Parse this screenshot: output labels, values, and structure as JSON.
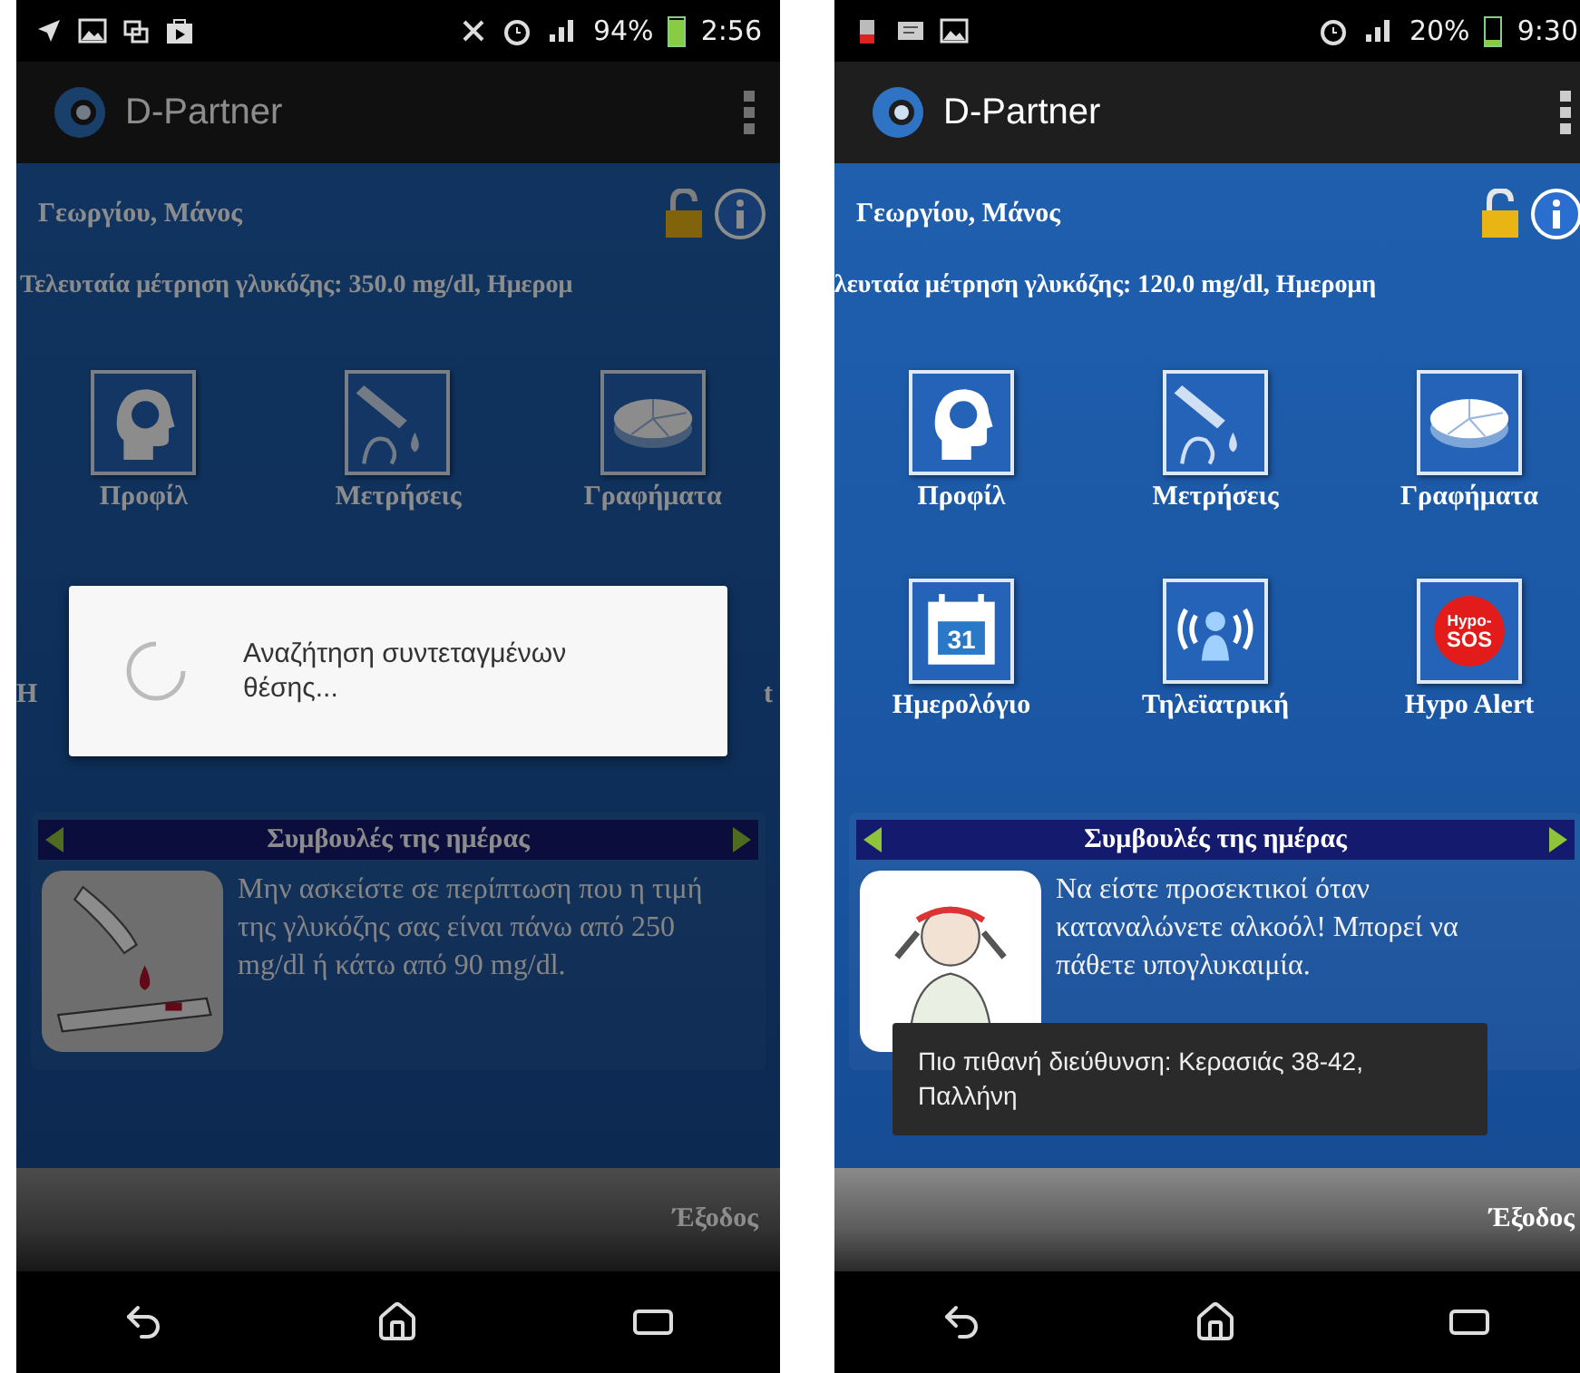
{
  "screens": [
    {
      "dimmed": true,
      "status_bar": {
        "battery": "94%",
        "time": "2:56"
      },
      "app_bar": {
        "title": "D-Partner"
      },
      "user_name": "Γεωργίου, Μάνος",
      "last_reading": "Τελευταία μέτρηση γλυκόζης: 350.0 mg/dl, Ημερομ",
      "tiles": [
        {
          "kind": "profile",
          "label": "Προφίλ"
        },
        {
          "kind": "measure",
          "label": "Μετρήσεις"
        },
        {
          "kind": "charts",
          "label": "Γραφήματα"
        }
      ],
      "partial_labels": [
        "Η",
        "t"
      ],
      "tips": {
        "title": "Συμβουλές της ημέρας",
        "kind": "blood-drop",
        "text": "Μην ασκείστε σε περίπτωση που η τιμή της γλυκόζης σας είναι πάνω από 250 mg/dl ή κάτω από 90 mg/dl."
      },
      "dialog": {
        "message": "Αναζήτηση συντεταγμένων θέσης..."
      },
      "exit": "Έξοδος"
    },
    {
      "dimmed": false,
      "status_bar": {
        "battery": "20%",
        "time": "9:30"
      },
      "app_bar": {
        "title": "D-Partner"
      },
      "user_name": "Γεωργίου, Μάνος",
      "last_reading": "λευταία μέτρηση γλυκόζης: 120.0 mg/dl, Ημερομη",
      "tiles": [
        {
          "kind": "profile",
          "label": "Προφίλ"
        },
        {
          "kind": "measure",
          "label": "Μετρήσεις"
        },
        {
          "kind": "charts",
          "label": "Γραφήματα"
        },
        {
          "kind": "calendar",
          "label": "Ημερολόγιο",
          "icon_text": [
            "31"
          ]
        },
        {
          "kind": "telemedicine",
          "label": "Τηλεϊατρική"
        },
        {
          "kind": "sos",
          "label": "Hypo Alert",
          "icon_text": [
            "Hypo-",
            "SOS"
          ]
        }
      ],
      "tips": {
        "title": "Συμβουλές της ημέρας",
        "kind": "dizzy-person",
        "text": "Να είστε προσεκτικοί όταν καταναλώνετε αλκοόλ! Μπορεί να πάθετε υπογλυκαιμία."
      },
      "toast": "Πιο πιθανή διεύθυνση: Κερασιάς 38-42, Παλλήνη",
      "exit": "Έξοδος"
    }
  ]
}
